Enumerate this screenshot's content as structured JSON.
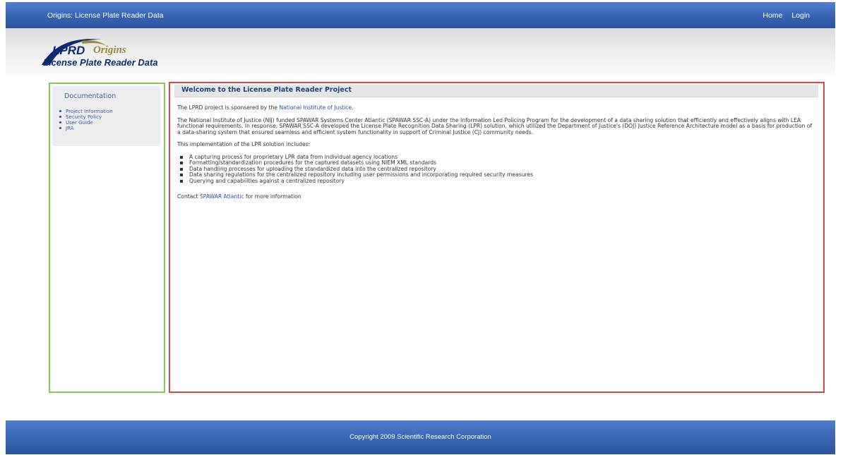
{
  "topbar": {
    "site_title": "Origins: License Plate Reader Data",
    "nav": {
      "home": "Home",
      "login": "Login"
    }
  },
  "logo": {
    "lprd": "LPRD",
    "origins": "Origins",
    "subtitle": "License Plate Reader Data"
  },
  "sidebar": {
    "heading": "Documentation",
    "items": [
      {
        "label": "Project Information"
      },
      {
        "label": "Security Policy"
      },
      {
        "label": "User Guide"
      },
      {
        "label": "JRA"
      }
    ]
  },
  "main": {
    "title": "Welcome to the License Plate Reader Project",
    "intro_prefix": "The LPRD project is sponsered by the ",
    "intro_link": "National Institute of Justice.",
    "paragraph": "The National Institute of Justice (NIJ) funded SPAWAR Systems Center Atlantic (SPAWAR SSC-A) under the Information Led Policing Program for the development of a data sharing solution that efficiently and effectively aligns with LEA functional requirements. In response, SPAWAR SSC-A developed the License Plate Recognition Data Sharing (LPR) solution, which utilized the Department of Justice's (DOJ) Justice Reference Architecture model as a basis for production of a data-sharing system that ensured seamless and efficient system functionality in support of Criminal Justice (CJ) community needs.",
    "includes_intro": "This implementation of the LPR solution includes:",
    "bullets": [
      "A capturing process for proprietary LPR data from individual agency locations",
      "Formatting/standardization procedures for the captured datasets using NIEM XML standards",
      "Data handling processes for uploading the standardized data into the centralized repository",
      "Data sharing regulations for the centralized repository including user permissions and incorporating required security measures",
      "Querying and capabilities against a centralized repository"
    ],
    "contact_prefix": "Contact ",
    "contact_link": "SPAWAR Atlantic",
    "contact_suffix": " for more information"
  },
  "footer": {
    "copyright": "Copyright 2009 Scientific Research Corporation"
  },
  "colors": {
    "bar_blue": "#3b69b8",
    "sidebar_border": "#84cc4c",
    "main_border": "#d34848",
    "link": "#2c4ea2",
    "logo_navy": "#0d2b70",
    "logo_gold": "#9a8a3c"
  }
}
